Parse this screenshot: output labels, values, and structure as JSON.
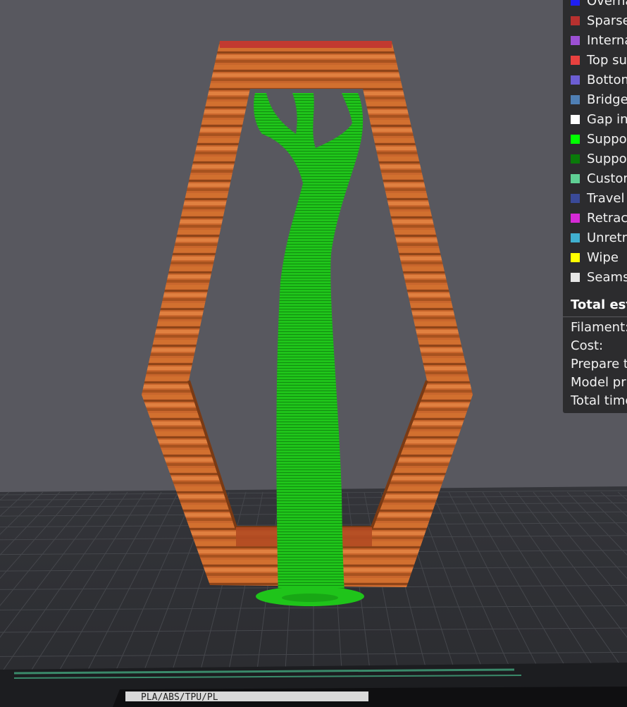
{
  "legend": {
    "items": [
      {
        "label": "Overhang wall",
        "color": "#1f1ff2"
      },
      {
        "label": "Sparse infill",
        "color": "#b8312f"
      },
      {
        "label": "Internal solid infill",
        "color": "#9c50d4"
      },
      {
        "label": "Top surface",
        "color": "#e8413f"
      },
      {
        "label": "Bottom surface",
        "color": "#6c5ed3"
      },
      {
        "label": "Bridge",
        "color": "#4f7fb4"
      },
      {
        "label": "Gap infill",
        "color": "#ffffff"
      },
      {
        "label": "Support",
        "color": "#00ff00"
      },
      {
        "label": "Support interface",
        "color": "#0a7a0a"
      },
      {
        "label": "Custom",
        "color": "#5fcf94"
      },
      {
        "label": "Travel",
        "color": "#3a4a98"
      },
      {
        "label": "Retract",
        "color": "#d62ad6"
      },
      {
        "label": "Unretract",
        "color": "#40b0d0"
      },
      {
        "label": "Wipe",
        "color": "#ffff00"
      },
      {
        "label": "Seams",
        "color": "#e6e6e6"
      }
    ],
    "total_estimation": "Total estimation",
    "stats": [
      {
        "label": "Filament:"
      },
      {
        "label": "Cost:"
      },
      {
        "label": "Prepare time:"
      },
      {
        "label": "Model printing time:"
      },
      {
        "label": "Total time:"
      }
    ]
  },
  "plate": {
    "label": "PLA/ABS/TPU/PL"
  },
  "colors": {
    "background": "#58585f",
    "bed": "#2f3034",
    "bed_grid": "#44464a",
    "model_orange": "#c8652c",
    "support_green": "#22b81c",
    "top_red": "#c23a30"
  }
}
